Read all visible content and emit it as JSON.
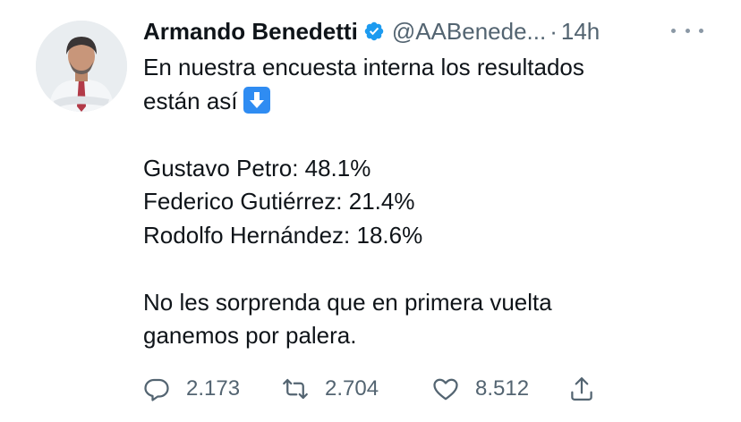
{
  "author": {
    "name": "Armando Benedetti",
    "handle": "@AABenede...",
    "separator": "·",
    "time": "14h"
  },
  "tweet": {
    "intro_line1": "En nuestra encuesta interna los resultados",
    "intro_line2": "están así",
    "results": [
      "Gustavo Petro: 48.1%",
      "Federico Gutiérrez: 21.4%",
      "Rodolfo Hernández: 18.6%"
    ],
    "closing_line1": "No les sorprenda que en primera vuelta",
    "closing_line2": "ganemos por palera."
  },
  "actions": {
    "replies": "2.173",
    "retweets": "2.704",
    "likes": "8.512"
  },
  "icons": {
    "verified": "verified-badge-icon",
    "emoji": "down-arrow-emoji",
    "reply": "reply-icon",
    "retweet": "retweet-icon",
    "like": "heart-icon",
    "share": "share-icon",
    "more": "more-icon"
  },
  "colors": {
    "text": "#0f1419",
    "secondary": "#536471",
    "verified": "#1d9bf0",
    "emoji_bg": "#2f8cf2"
  }
}
